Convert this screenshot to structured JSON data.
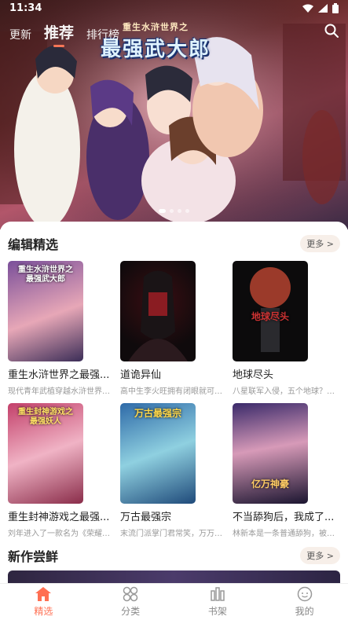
{
  "status": {
    "time": "11:34"
  },
  "nav": {
    "tabs": [
      "更新",
      "推荐",
      "排行榜"
    ],
    "active_index": 1
  },
  "hero": {
    "logo_small": "重生水浒世界之",
    "logo_big": "最强武大郎",
    "slide_count": 4,
    "active_slide": 0
  },
  "editor_picks": {
    "title": "编辑精选",
    "more_label": "更多 >",
    "items": [
      {
        "title": "重生水浒世界之最强...",
        "desc": "现代青年武植穿越水浒世界与...",
        "cover_text": "重生水浒世界之\n最强武大郎"
      },
      {
        "title": "道诡异仙",
        "desc": "高中生李火旺拥有闭眼就可以...",
        "cover_text": ""
      },
      {
        "title": "地球尽头",
        "desc": "八星联军入侵，五个地球？五...",
        "cover_text": "地球尽头"
      },
      {
        "title": "重生封神游戏之最强...",
        "desc": "刘年进入了一款名为《荣耀大...",
        "cover_text": "重生封神游戏之\n最强妖人"
      },
      {
        "title": "万古最强宗",
        "desc": "末流门派掌门君常笑，万万没...",
        "cover_text": "万古最强宗"
      },
      {
        "title": "不当舔狗后，我成了...",
        "desc": "林新本是一条普通舔狗，被甩...",
        "cover_text": "亿万神豪"
      }
    ]
  },
  "new_works": {
    "title": "新作尝鲜",
    "more_label": "更多 >"
  },
  "tabbar": {
    "items": [
      "精选",
      "分类",
      "书架",
      "我的"
    ],
    "active_index": 0
  },
  "colors": {
    "accent": "#ff6f52"
  }
}
